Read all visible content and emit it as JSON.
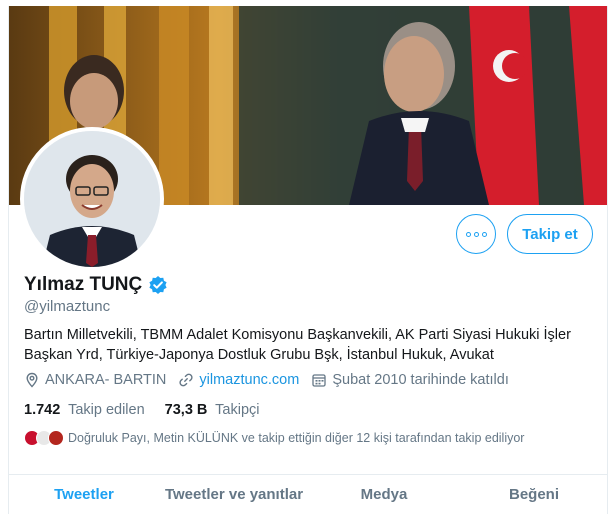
{
  "profile": {
    "display_name": "Yılmaz TUNÇ",
    "handle": "@yilmaztunc",
    "bio": "Bartın Milletvekili, TBMM Adalet Komisyonu Başkanvekili, AK Parti Siyasi Hukuki İşler Başkan Yrd, Türkiye-Japonya Dostluk Grubu Bşk, İstanbul Hukuk, Avukat",
    "location": "ANKARA- BARTIN",
    "website": "yilmaztunc.com",
    "joined": "Şubat 2010 tarihinde katıldı",
    "verified": true
  },
  "actions": {
    "follow_label": "Takip et"
  },
  "stats": {
    "following_count": "1.742",
    "following_label": "Takip edilen",
    "followers_count": "73,3 B",
    "followers_label": "Takipçi"
  },
  "followers_you_know": {
    "text": "Doğruluk Payı, Metin KÜLÜNK ve takip ettiğin diğer 12 kişi tarafından takip ediliyor"
  },
  "tabs": [
    {
      "label": "Tweetler",
      "active": true
    },
    {
      "label": "Tweetler ve yanıtlar",
      "active": false
    },
    {
      "label": "Medya",
      "active": false
    },
    {
      "label": "Beğeni",
      "active": false
    }
  ],
  "colors": {
    "accent": "#1da1f2",
    "link": "#1b95e0",
    "muted": "#657786",
    "text": "#14171a"
  },
  "icons": [
    "verified-badge-icon",
    "more-dots-icon",
    "location-pin-icon",
    "link-icon",
    "calendar-icon"
  ]
}
